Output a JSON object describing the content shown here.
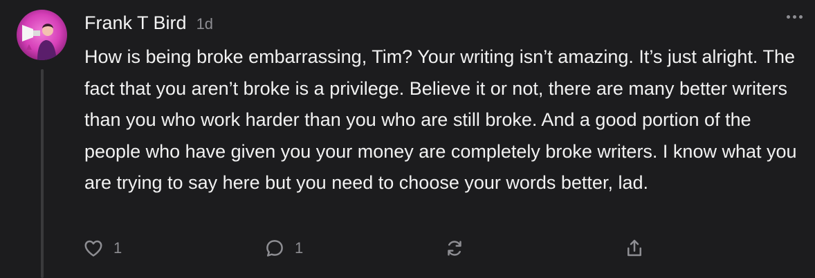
{
  "comment": {
    "author": "Frank T Bird",
    "age": "1d",
    "body": "How is being broke embarrassing, Tim? Your writing isn’t amazing. It’s just alright. The fact that you aren’t broke is a privilege. Believe it or not, there are many better writers than you who work harder than you who are still broke. And a good portion of the people who have given you your money are completely broke writers. I know what you are trying to say here but you need to choose your words better, lad.",
    "actions": {
      "like_count": "1",
      "reply_count": "1"
    }
  },
  "icons": {
    "like": "heart-icon",
    "reply": "speech-bubble-icon",
    "restack": "restack-arrows-icon",
    "share": "share-upload-icon",
    "more": "ellipsis-icon"
  },
  "colors": {
    "background": "#1c1c1e",
    "text": "#f2f2f2",
    "muted": "#8e8e93",
    "avatar_accent": "#d63fb8"
  }
}
